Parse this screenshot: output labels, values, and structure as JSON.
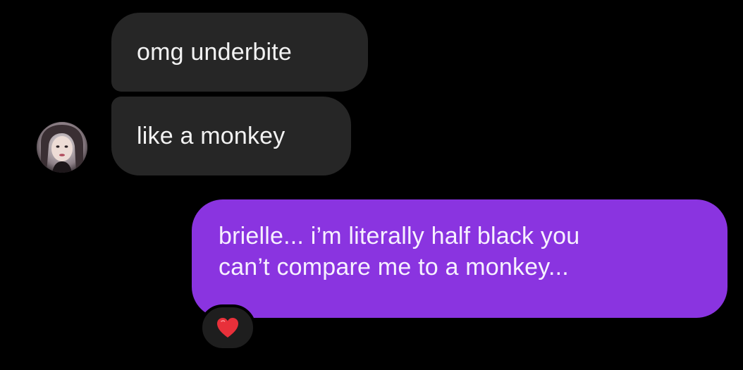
{
  "conversation": {
    "incoming_messages": [
      {
        "text": "omg underbite"
      },
      {
        "text": "like a monkey"
      }
    ],
    "outgoing_message": {
      "lines": [
        "brielle... i’m literally half black you",
        "can’t compare me to a monkey..."
      ]
    },
    "reaction": {
      "icon": "red-heart-icon",
      "color": "#e8303a"
    },
    "avatar": {
      "icon": "profile-photo-avatar"
    }
  },
  "colors": {
    "background": "#000000",
    "incoming_bubble": "#262626",
    "outgoing_bubble": "#8a34e0",
    "text": "#ffffff"
  }
}
